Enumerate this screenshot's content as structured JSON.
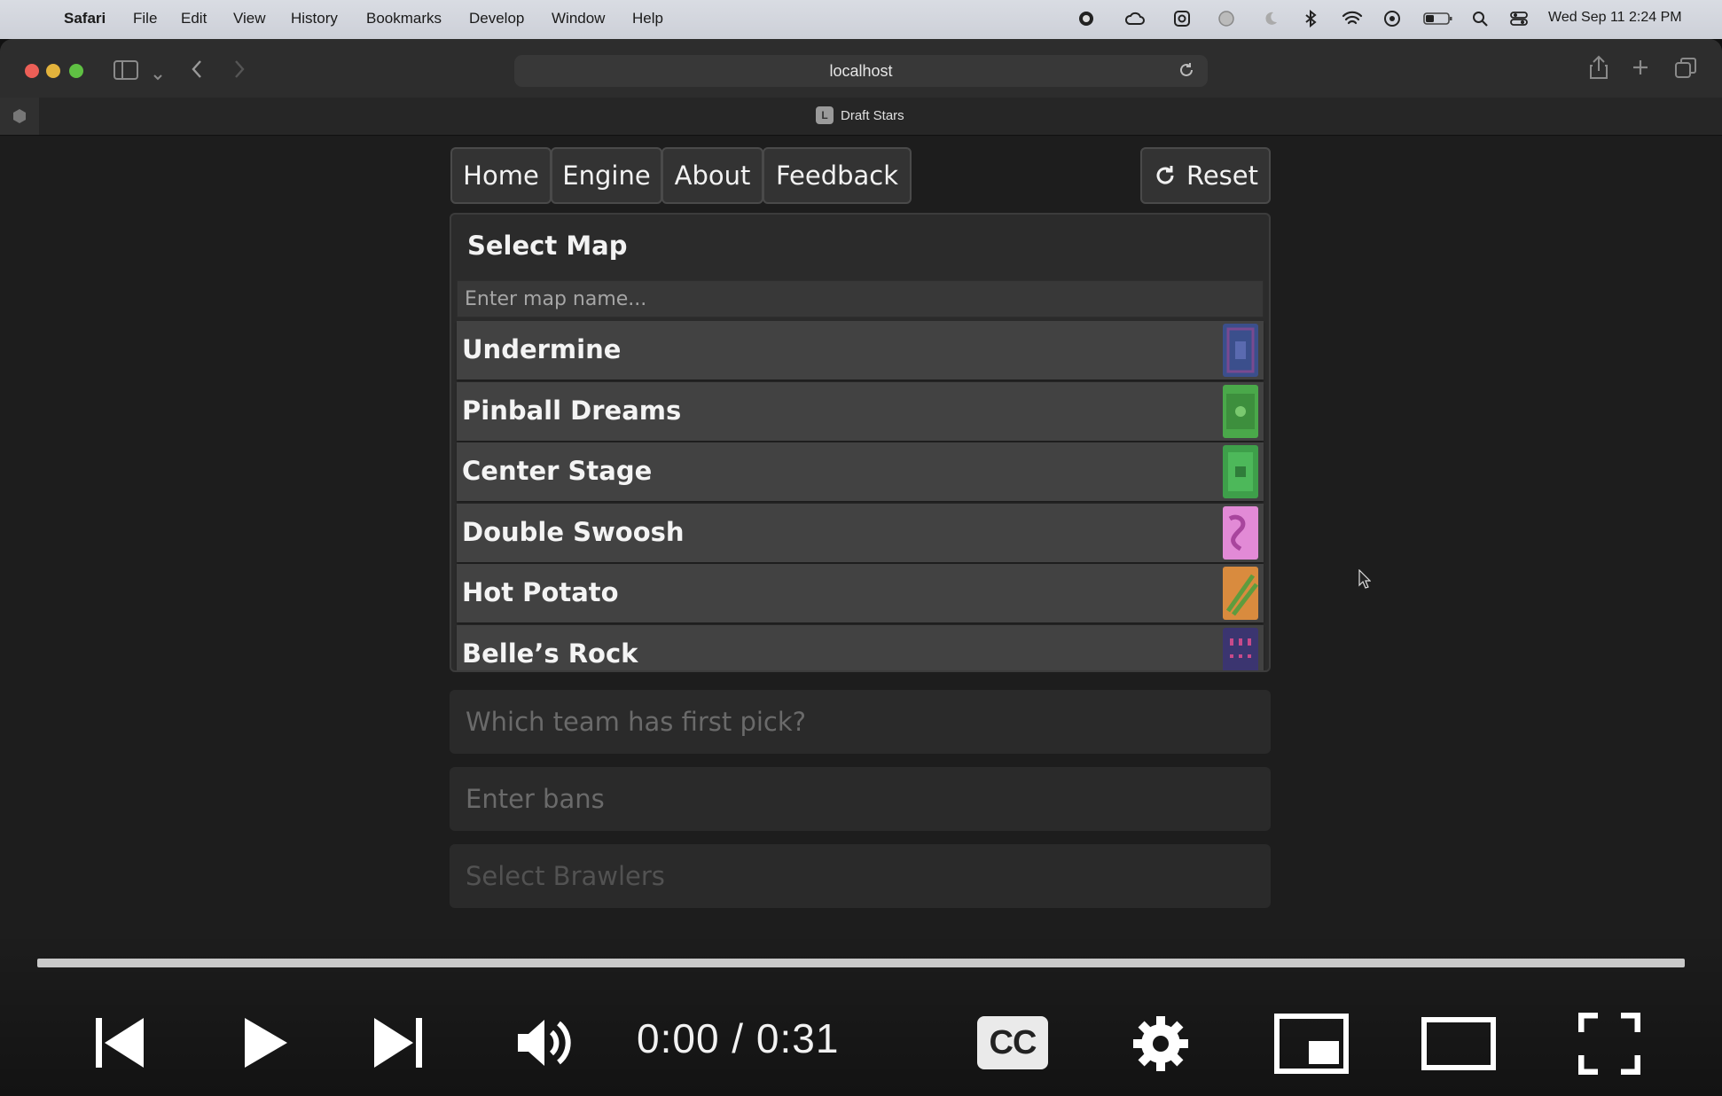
{
  "menubar": {
    "app": "Safari",
    "items": [
      "File",
      "Edit",
      "View",
      "History",
      "Bookmarks",
      "Develop",
      "Window",
      "Help"
    ],
    "clock": "Wed Sep 11  2:24 PM"
  },
  "browser": {
    "url": "localhost",
    "tab_title": "Draft Stars",
    "favicon_letter": "L"
  },
  "nav": {
    "home": "Home",
    "engine": "Engine",
    "about": "About",
    "feedback": "Feedback",
    "reset": "Reset"
  },
  "select_map": {
    "title": "Select Map",
    "placeholder": "Enter map name...",
    "maps": [
      {
        "name": "Undermine",
        "thumb_color": "#3b4f8c"
      },
      {
        "name": "Pinball Dreams",
        "thumb_color": "#4aa84a"
      },
      {
        "name": "Center Stage",
        "thumb_color": "#3e9f4a"
      },
      {
        "name": "Double Swoosh",
        "thumb_color": "#e28ad6"
      },
      {
        "name": "Hot Potato",
        "thumb_color": "#d98b3e"
      },
      {
        "name": "Belle’s Rock",
        "thumb_color": "#3b3570"
      }
    ]
  },
  "fields": {
    "first_pick": "Which team has first pick?",
    "bans": "Enter bans",
    "brawlers": "Select Brawlers"
  },
  "video": {
    "time": "0:00 / 0:31",
    "cc_label": "CC"
  }
}
